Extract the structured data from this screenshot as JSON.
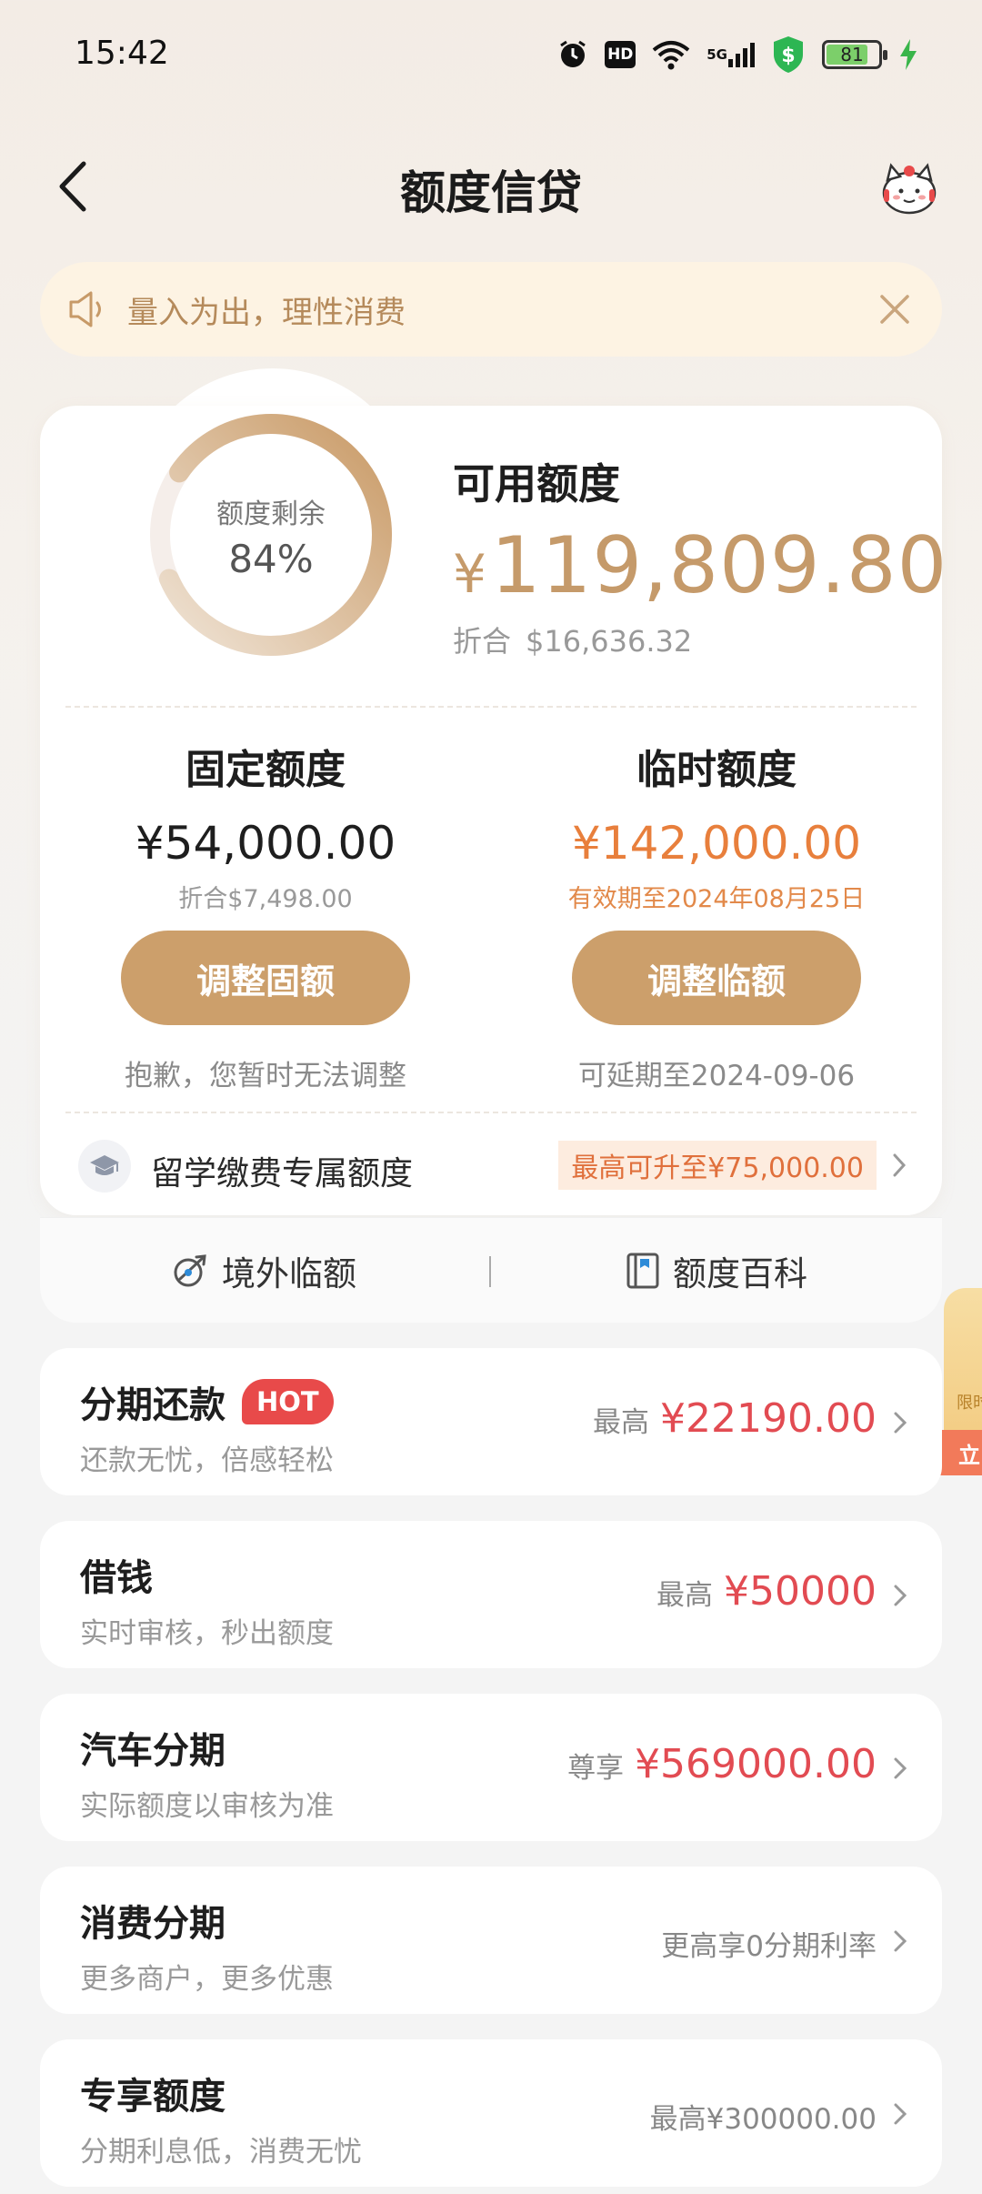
{
  "status": {
    "time": "15:42",
    "hd": "HD",
    "net": "5G",
    "battery": "81",
    "battery_level": 0.81
  },
  "header": {
    "title": "额度信贷"
  },
  "notice": {
    "text": "量入为出，理性消费"
  },
  "summary": {
    "ring_label": "额度剩余",
    "ring_percent": "84%",
    "ring_fraction": 0.84,
    "available_label": "可用额度",
    "available_currency": "¥",
    "available_amount": "119,809.80",
    "usd_prefix": "折合",
    "usd_amount": "$16,636.32"
  },
  "fixed": {
    "title": "固定额度",
    "amount": "¥54,000.00",
    "sub": "折合$7,498.00",
    "button": "调整固额",
    "note": "抱歉，您暂时无法调整"
  },
  "temp": {
    "title": "临时额度",
    "amount": "¥142,000.00",
    "sub": "有效期至2024年08月25日",
    "button": "调整临额",
    "note": "可延期至2024-09-06"
  },
  "study": {
    "label": "留学缴费专属额度",
    "badge": "最高可升至¥75,000.00"
  },
  "footer": {
    "left": "境外临额",
    "right": "额度百科"
  },
  "side_tab": {
    "text": "限时",
    "button": "立"
  },
  "services": [
    {
      "title": "分期还款",
      "badge": "HOT",
      "sub": "还款无忧，倍感轻松",
      "prefix": "最高",
      "amount": "¥22190.00"
    },
    {
      "title": "借钱",
      "sub": "实时审核，秒出额度",
      "prefix": "最高",
      "amount": "¥50000"
    },
    {
      "title": "汽车分期",
      "sub": "实际额度以审核为准",
      "prefix": "尊享",
      "amount": "¥569000.00"
    },
    {
      "title": "消费分期",
      "sub": "更多商户，更多优惠",
      "plain": "更高享0分期利率"
    },
    {
      "title": "专享额度",
      "sub": "分期利息低，消费无忧",
      "plain": "最高¥300000.00"
    }
  ],
  "colors": {
    "accent_gold": "#cc9f6b",
    "amount_gold": "#c59a6a",
    "temp_orange": "#e87f3c",
    "service_red": "#e24b52",
    "hot_red": "#e84a4a"
  }
}
